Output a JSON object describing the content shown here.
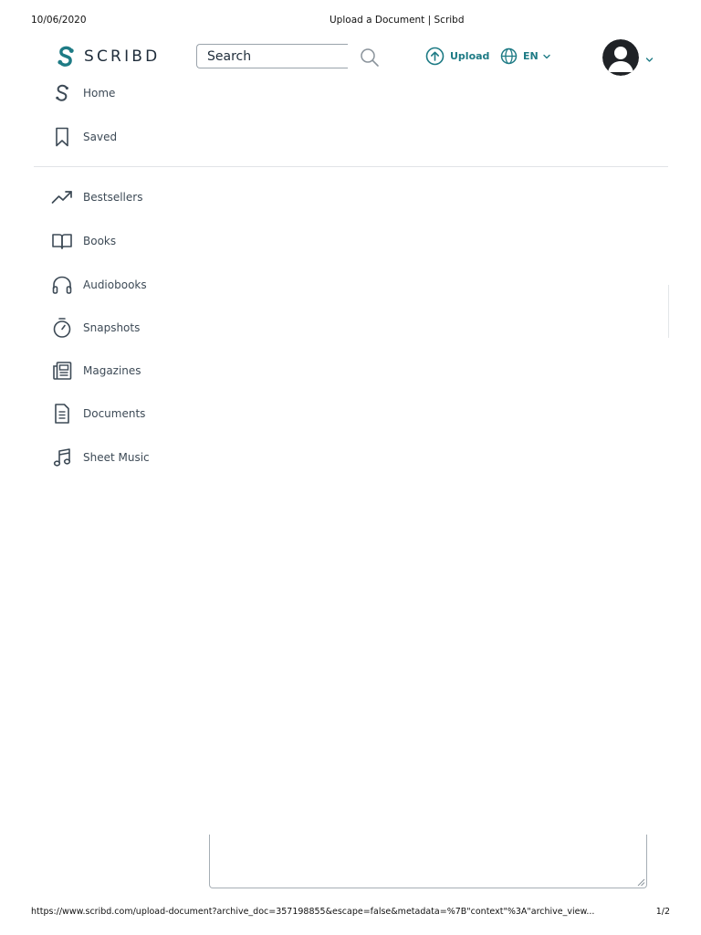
{
  "print": {
    "date": "10/06/2020",
    "title": "Upload a Document | Scribd",
    "url": "https://www.scribd.com/upload-document?archive_doc=357198855&escape=false&metadata=%7B\"context\"%3A\"archive_view...",
    "page": "1/2"
  },
  "header": {
    "logo_text": "SCRIBD",
    "search_placeholder": "Search",
    "upload_label": "Upload",
    "language_label": "EN"
  },
  "nav": {
    "primary": [
      {
        "label": "Home",
        "icon": "scribd-home-icon"
      },
      {
        "label": "Saved",
        "icon": "bookmark-icon"
      }
    ],
    "categories": [
      {
        "label": "Bestsellers",
        "icon": "trending-up-icon"
      },
      {
        "label": "Books",
        "icon": "open-book-icon"
      },
      {
        "label": "Audiobooks",
        "icon": "headphones-icon"
      },
      {
        "label": "Snapshots",
        "icon": "stopwatch-icon"
      },
      {
        "label": "Magazines",
        "icon": "magazine-icon"
      },
      {
        "label": "Documents",
        "icon": "document-icon"
      },
      {
        "label": "Sheet Music",
        "icon": "music-note-icon"
      }
    ]
  },
  "colors": {
    "brand_teal": "#1e7b85",
    "text_dark": "#1e2c3a",
    "nav_text": "#3d4a56"
  }
}
